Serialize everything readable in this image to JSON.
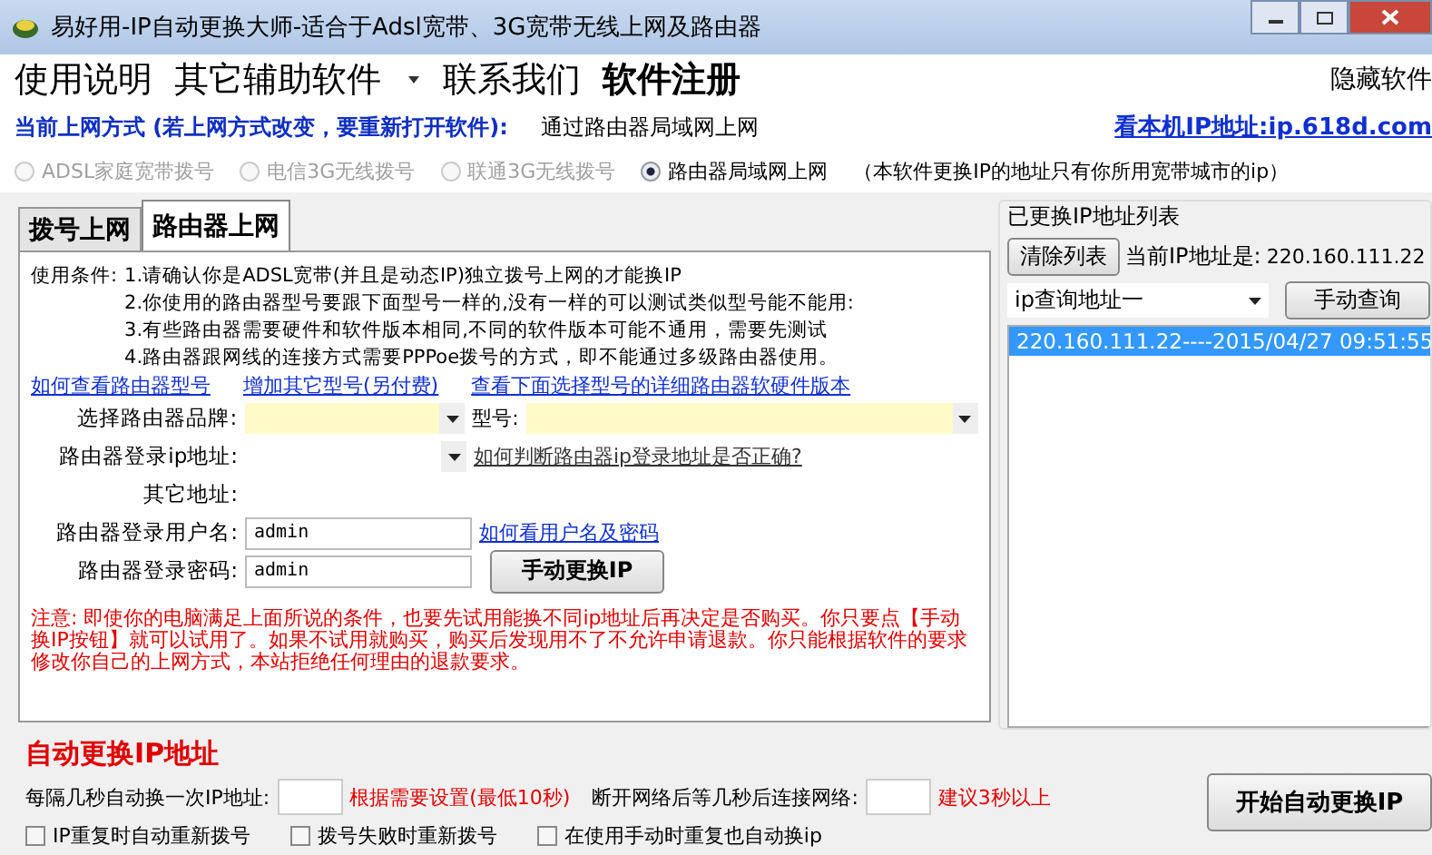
{
  "window": {
    "title": "易好用-IP自动更换大师-适合于Adsl宽带、3G宽带无线上网及路由器"
  },
  "menu": [
    {
      "label": "使用说明",
      "kind": "plain"
    },
    {
      "label": "其它辅助软件",
      "kind": "dropdown"
    },
    {
      "label": "联系我们",
      "kind": "plain"
    },
    {
      "label": "软件注册",
      "kind": "bold"
    }
  ],
  "hide_link": "隐藏软件",
  "mode_label": "当前上网方式 (若上网方式改变，要重新打开软件):",
  "mode_value": "通过路由器局域网上网",
  "ip_link": "看本机IP地址:ip.618d.com",
  "radios": [
    {
      "label": "ADSL家庭宽带拨号",
      "selected": false,
      "disabled": true
    },
    {
      "label": "电信3G无线拨号",
      "selected": false,
      "disabled": true
    },
    {
      "label": "联通3G无线拨号",
      "selected": false,
      "disabled": true
    },
    {
      "label": "路由器局域网上网",
      "selected": true,
      "disabled": false
    }
  ],
  "radio_note": "（本软件更换IP的地址只有你所用宽带城市的ip）",
  "tabs": [
    {
      "label": "拨号上网",
      "selected": false
    },
    {
      "label": "路由器上网",
      "selected": true
    }
  ],
  "conditions_label": "使用条件:",
  "conditions": [
    "1.请确认你是ADSL宽带(并且是动态IP)独立拨号上网的才能换IP",
    "2.你使用的路由器型号要跟下面型号一样的,没有一样的可以测试类似型号能不能用:",
    "3.有些路由器需要硬件和软件版本相同,不同的软件版本可能不通用，需要先测试",
    "4.路由器跟网线的连接方式需要PPPoe拨号的方式，即不能通过多级路由器使用。"
  ],
  "links": [
    "如何查看路由器型号",
    "增加其它型号(另付费)",
    "查看下面选择型号的详细路由器软硬件版本"
  ],
  "brand_label": "选择路由器品牌:",
  "model_label": "型号:",
  "login_ip_label": "路由器登录ip地址:",
  "login_ip_link": "如何判断路由器ip登录地址是否正确?",
  "other_label": "其它地址:",
  "user_label": "路由器登录用户名:",
  "user_value": "admin",
  "user_link": "如何看用户名及密码",
  "pass_label": "路由器登录密码:",
  "pass_value": "admin",
  "manual_button": "手动更换IP",
  "notice": "注意: 即使你的电脑满足上面所说的条件，也要先试用能换不同ip地址后再决定是否购买。你只要点【手动换IP按钮】就可以试用了。如果不试用就购买，购买后发现用不了不允许申请退款。你只能根据软件的要求修改你自己的上网方式，本站拒绝任何理由的退款要求。",
  "right": {
    "title": "已更换IP地址列表",
    "clear_button": "清除列表",
    "current_label": "当前IP地址是:",
    "current_ip": "220.160.111.22",
    "query_select": "ip查询地址一",
    "query_button": "手动查询",
    "list": [
      {
        "text": "220.160.111.22----2015/04/27 09:51:55",
        "selected": true
      }
    ]
  },
  "auto": {
    "title": "自动更换IP地址",
    "interval_label": "每隔几秒自动换一次IP地址:",
    "interval_hint": "根据需要设置(最低10秒)",
    "wait_label": "断开网络后等几秒后连接网络:",
    "wait_hint": "建议3秒以上",
    "start_button": "开始自动更换IP",
    "checks": [
      {
        "label": "IP重复时自动重新拨号",
        "checked": false
      },
      {
        "label": "拨号失败时重新拨号",
        "checked": false
      },
      {
        "label": "在使用手动时重复也自动换ip",
        "checked": false
      }
    ]
  }
}
